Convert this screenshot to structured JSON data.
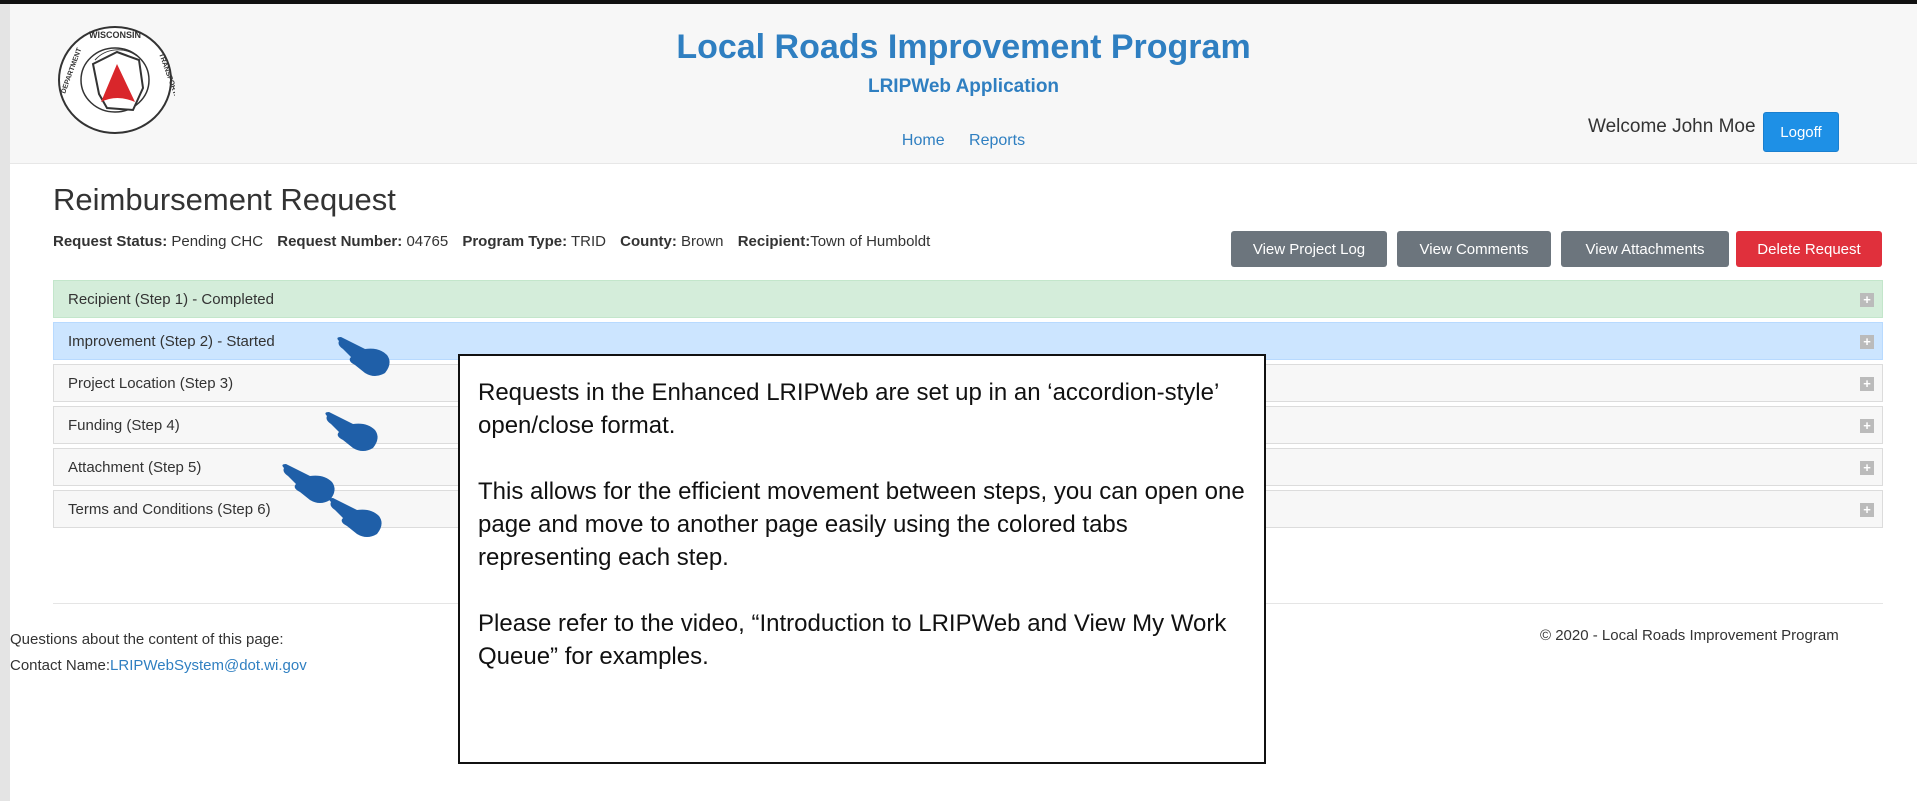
{
  "header": {
    "app_title": "Local Roads Improvement Program",
    "app_subtitle": "LRIPWeb Application",
    "nav": [
      "Home",
      "Reports"
    ],
    "welcome": "Welcome John Moe",
    "logoff_label": "Logoff",
    "logo_text_top": "WISCONSIN",
    "logo_text_left": "DEPARTMENT",
    "logo_text_right": "TRANSPORTATION"
  },
  "page": {
    "title": "Reimbursement Request",
    "meta": [
      {
        "label": "Request Status:",
        "value": "Pending CHC"
      },
      {
        "label": "Request Number:",
        "value": "04765"
      },
      {
        "label": "Program Type:",
        "value": "TRID"
      },
      {
        "label": "County:",
        "value": "Brown"
      },
      {
        "label": "Recipient:",
        "value": "Town of Humboldt"
      }
    ],
    "buttons": {
      "project_log": "View Project Log",
      "comments": "View Comments",
      "attachments": "View Attachments",
      "delete": "Delete Request"
    }
  },
  "accordion": [
    {
      "label": "Recipient (Step 1) - Completed",
      "state": "completed"
    },
    {
      "label": "Improvement (Step 2) - Started",
      "state": "started"
    },
    {
      "label": "Project Location (Step 3)",
      "state": "default"
    },
    {
      "label": "Funding (Step 4)",
      "state": "default"
    },
    {
      "label": "Attachment (Step 5)",
      "state": "default"
    },
    {
      "label": "Terms and Conditions (Step 6)",
      "state": "default"
    }
  ],
  "accordion_toggle_symbol": "+",
  "footer": {
    "questions": "Questions about the content of this page:",
    "contact_label": "Contact Name:",
    "contact_email": "LRIPWebSystem@dot.wi.gov",
    "copyright": "© 2020 - Local Roads Improvement Program"
  },
  "callout": {
    "paragraphs": [
      "Requests in the Enhanced LRIPWeb are set up in an ‘accordion-style’ open/close format.",
      "This allows for the efficient movement between steps, you can open one page and move to another page easily using the colored tabs representing each step.",
      "Please refer to the video, “Introduction to LRIPWeb and View My Work Queue” for examples."
    ]
  },
  "colors": {
    "brand_blue": "#2f7fc1",
    "logoff_blue": "#1e90e6",
    "secondary_gray": "#6c757d",
    "danger_red": "#e0303c",
    "completed_green": "#d4edda",
    "started_blue": "#cce5ff",
    "pointer_hand": "#1f5fa8"
  },
  "icons": [
    "wisdot-logo",
    "pointer-hand-icon",
    "expand-plus-icon"
  ]
}
